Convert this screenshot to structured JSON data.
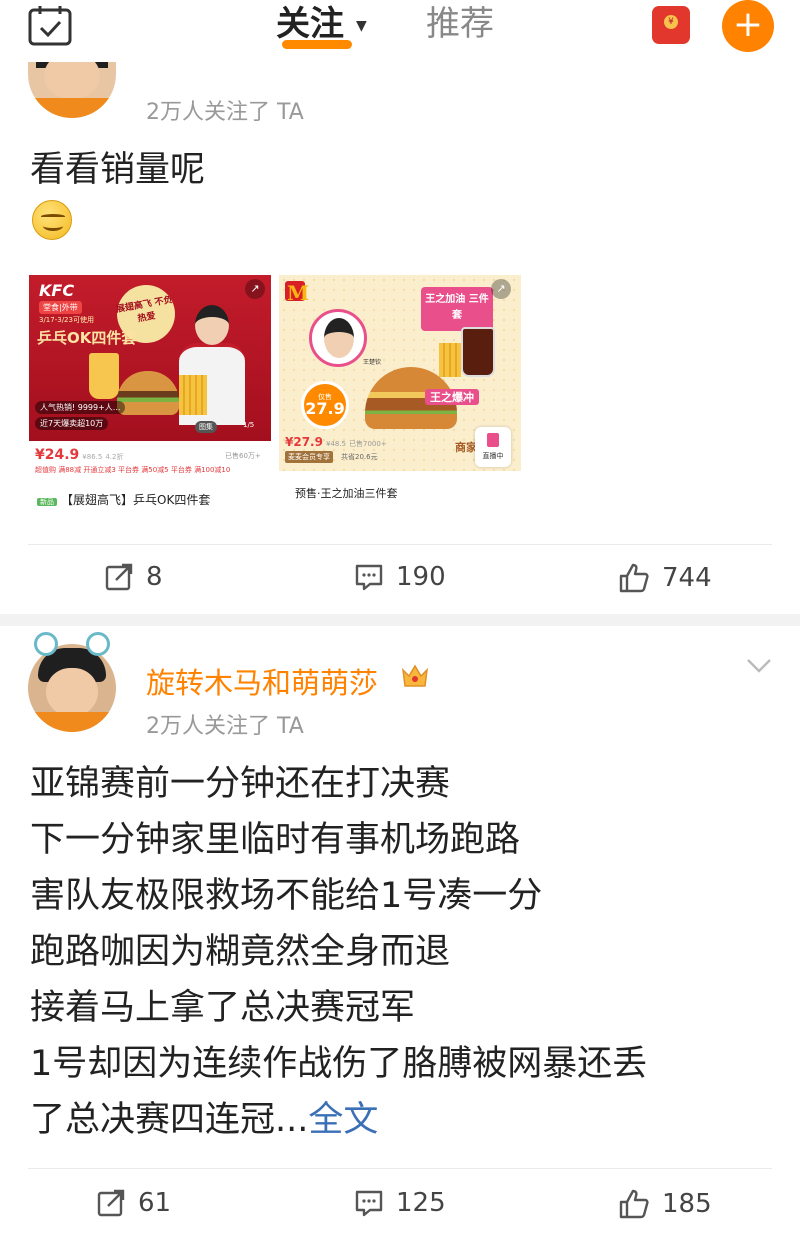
{
  "topbar": {
    "tab_follow": "关注",
    "tab_recommend": "推荐",
    "accent_color": "#ff8200"
  },
  "post1": {
    "followers": "2万人关注了 TA",
    "text": "看看销量呢",
    "kfc": {
      "logo": "KFC",
      "tag": "堂食|外带",
      "date": "3/17-3/23可使用",
      "slogan": "展翅高飞 不负热爱",
      "title": "乒乓OK四件套",
      "badge_hot": "人气热销! 9999+人...",
      "badge_sold": "近7天爆卖超10万",
      "pic_btn": "图集",
      "pager": "1/5",
      "price": "¥24.9",
      "price_orig": "¥86.5",
      "discount": "4.2折",
      "sold": "已售60万+",
      "coupons": "超值购  满88减  开通立减3  平台券  满50减5  平台券  满100减10",
      "label": "新品",
      "name": "【展翅高飞】乒乓OK四件套"
    },
    "mcd": {
      "logo": "M",
      "title": "王之加油 三件套",
      "person_name": "王楚钦",
      "badge_label": "仅售",
      "badge_price": "27.9",
      "king": "王之爆冲",
      "price": "¥27.9",
      "price_orig": "¥48.5",
      "sold": "已售7000+",
      "member": "麦麦会员专享",
      "cut": "共省20.6元",
      "live": "直播中",
      "shop": "商家",
      "name": "预售·王之加油三件套"
    },
    "reposts": "8",
    "comments": "190",
    "likes": "744"
  },
  "post2": {
    "username": "旋转木马和萌萌莎",
    "followers": "2万人关注了 TA",
    "lines": [
      "亚锦赛前一分钟还在打决赛",
      "下一分钟家里临时有事机场跑路",
      "害队友极限救场不能给1号凑一分",
      "跑路咖因为糊竟然全身而退",
      "接着马上拿了总决赛冠军",
      "1号却因为连续作战伤了胳膊被网暴还丢",
      "了总决赛四连冠..."
    ],
    "read_more": "全文",
    "reposts": "61",
    "comments": "125",
    "likes": "185"
  }
}
